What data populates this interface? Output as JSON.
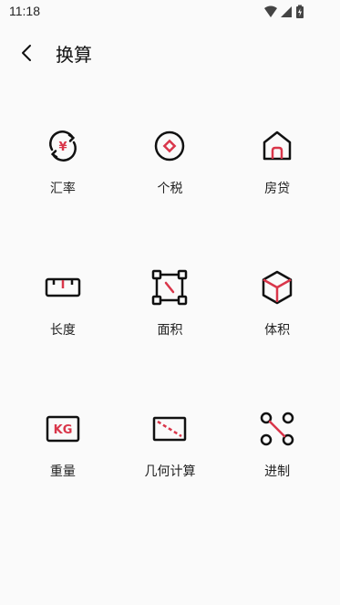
{
  "status_bar": {
    "time": "11:18",
    "icons": [
      "wifi-icon",
      "signal-icon",
      "battery-charging-icon"
    ]
  },
  "header": {
    "title": "换算",
    "back_icon": "back-arrow-icon"
  },
  "colors": {
    "accent": "#d9364a",
    "icon_stroke": "#111111",
    "background": "#fafafa"
  },
  "tools": [
    {
      "label": "汇率",
      "icon": "currency-exchange-icon"
    },
    {
      "label": "个税",
      "icon": "tax-icon"
    },
    {
      "label": "房贷",
      "icon": "house-loan-icon"
    },
    {
      "label": "长度",
      "icon": "ruler-icon"
    },
    {
      "label": "面积",
      "icon": "area-icon"
    },
    {
      "label": "体积",
      "icon": "volume-cube-icon"
    },
    {
      "label": "重量",
      "icon": "weight-kg-icon"
    },
    {
      "label": "几何计算",
      "icon": "geometry-icon"
    },
    {
      "label": "进制",
      "icon": "number-base-icon"
    }
  ]
}
